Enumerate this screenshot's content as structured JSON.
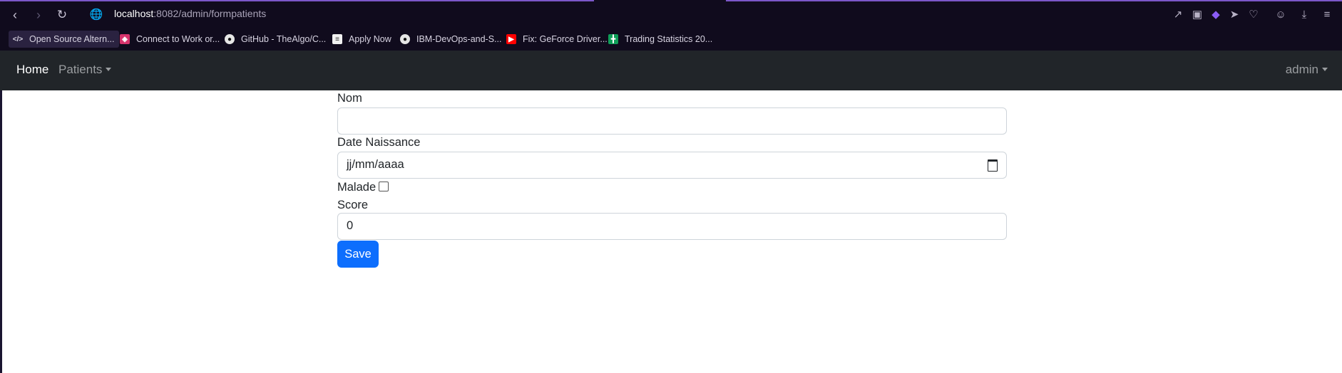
{
  "browser": {
    "accent_color": "#7b57c9",
    "url_host": "localhost",
    "url_path": ":8082/admin/formpatients",
    "nav": {
      "back_icon": "chevron-left-icon",
      "forward_icon": "chevron-right-icon",
      "reload_icon": "reload-icon",
      "site_icon": "globe-icon"
    },
    "toolbar_icons": [
      "share-icon",
      "camera-icon",
      "shield-icon",
      "send-icon",
      "heart-icon",
      "profile-icon",
      "download-icon",
      "menu-icon"
    ],
    "bookmarks": [
      {
        "label": "Open Source Altern...",
        "icon": "code-icon"
      },
      {
        "label": "Connect to Work or...",
        "icon": "app-icon"
      },
      {
        "label": "GitHub - TheAlgo/C...",
        "icon": "github-icon"
      },
      {
        "label": "Apply Now",
        "icon": "document-icon"
      },
      {
        "label": "IBM-DevOps-and-S...",
        "icon": "github-icon"
      },
      {
        "label": "Fix: GeForce Driver...",
        "icon": "youtube-icon"
      },
      {
        "label": "Trading Statistics 20...",
        "icon": "sheets-icon"
      }
    ]
  },
  "navbar": {
    "home": "Home",
    "patients": "Patients",
    "user": "admin"
  },
  "form": {
    "nom_label": "Nom",
    "nom_value": "",
    "date_label": "Date Naissance",
    "date_placeholder": "jj/mm/aaaa",
    "malade_label": "Malade",
    "malade_checked": false,
    "score_label": "Score",
    "score_value": "0",
    "save_label": "Save",
    "save_color": "#0d6efd"
  }
}
